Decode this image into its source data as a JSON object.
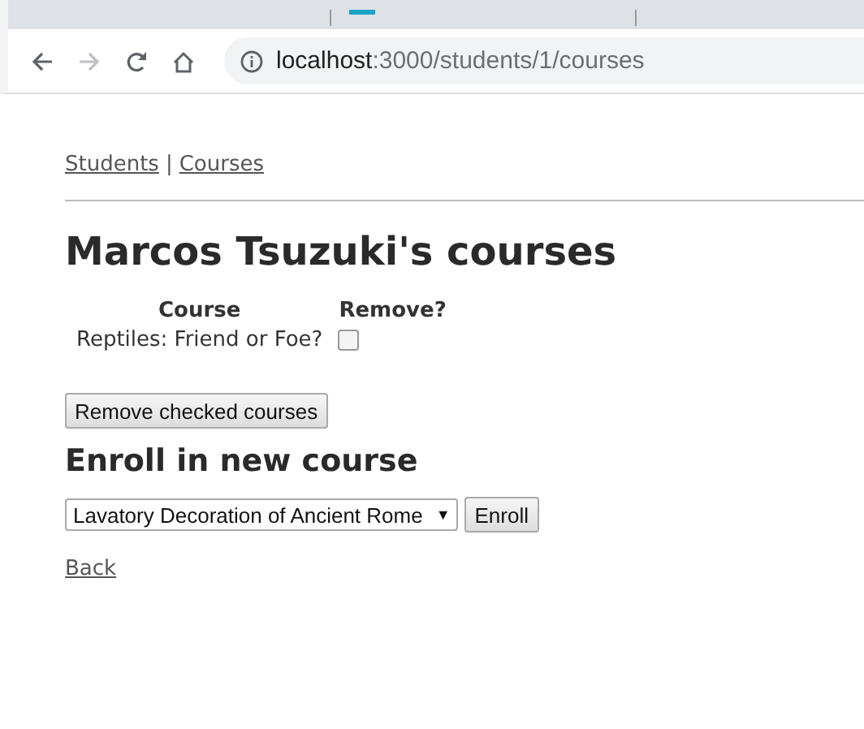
{
  "browser": {
    "url_host": "localhost",
    "url_path": ":3000/students/1/courses"
  },
  "nav": {
    "links": [
      "Students",
      "Courses"
    ],
    "separator": "|"
  },
  "heading": "Marcos Tsuzuki's courses",
  "table": {
    "columns": [
      "Course",
      "Remove?"
    ],
    "rows": [
      {
        "course": "Reptiles: Friend or Foe?",
        "checked": false
      }
    ]
  },
  "remove_button": "Remove checked courses",
  "enroll": {
    "heading": "Enroll in new course",
    "selected_course": "Lavatory Decoration of Ancient Rome",
    "arrow": "▼",
    "button": "Enroll"
  },
  "back_link": "Back"
}
